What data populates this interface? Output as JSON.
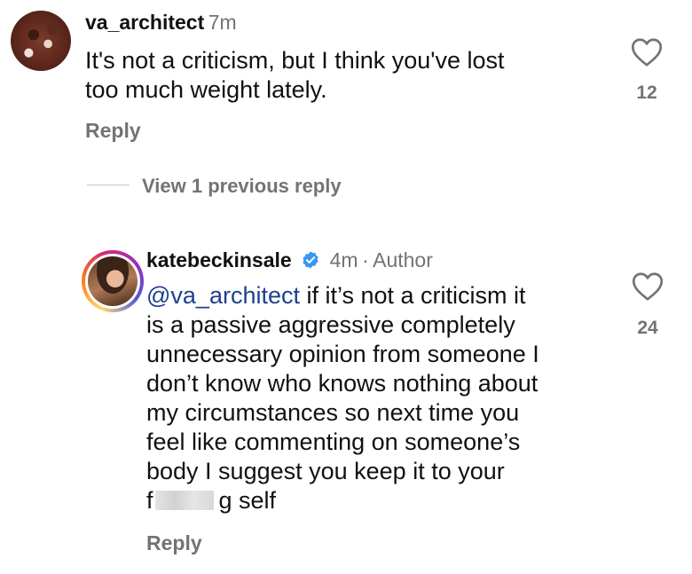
{
  "comment1": {
    "username": "va_architect",
    "time": "7m",
    "text_line1": "It's not a criticism, but I think you've lost",
    "text_line2": "too much weight lately.",
    "likes": "12",
    "reply_label": "Reply"
  },
  "view_previous_label": "View 1 previous reply",
  "comment2": {
    "username": "katebeckinsale",
    "time": "4m",
    "separator": "·",
    "role": "Author",
    "mention": "@va_architect",
    "line1_rest": " if it’s not a criticism it",
    "line2": "is a passive aggressive completely",
    "line3": "unnecessary opinion from someone I",
    "line4": "don’t know who knows nothing about",
    "line5": "my circumstances so next time you",
    "line6": "feel like commenting on someone’s",
    "line7": "body I suggest you keep it to your",
    "line8_start": "f",
    "line8_end": "g self",
    "likes": "24",
    "reply_label": "Reply"
  },
  "icons": {
    "like": "heart-icon",
    "verified": "verified-badge-icon"
  },
  "colors": {
    "verified": "#3897f0",
    "mention": "#1f3f8f",
    "muted": "#737373"
  }
}
